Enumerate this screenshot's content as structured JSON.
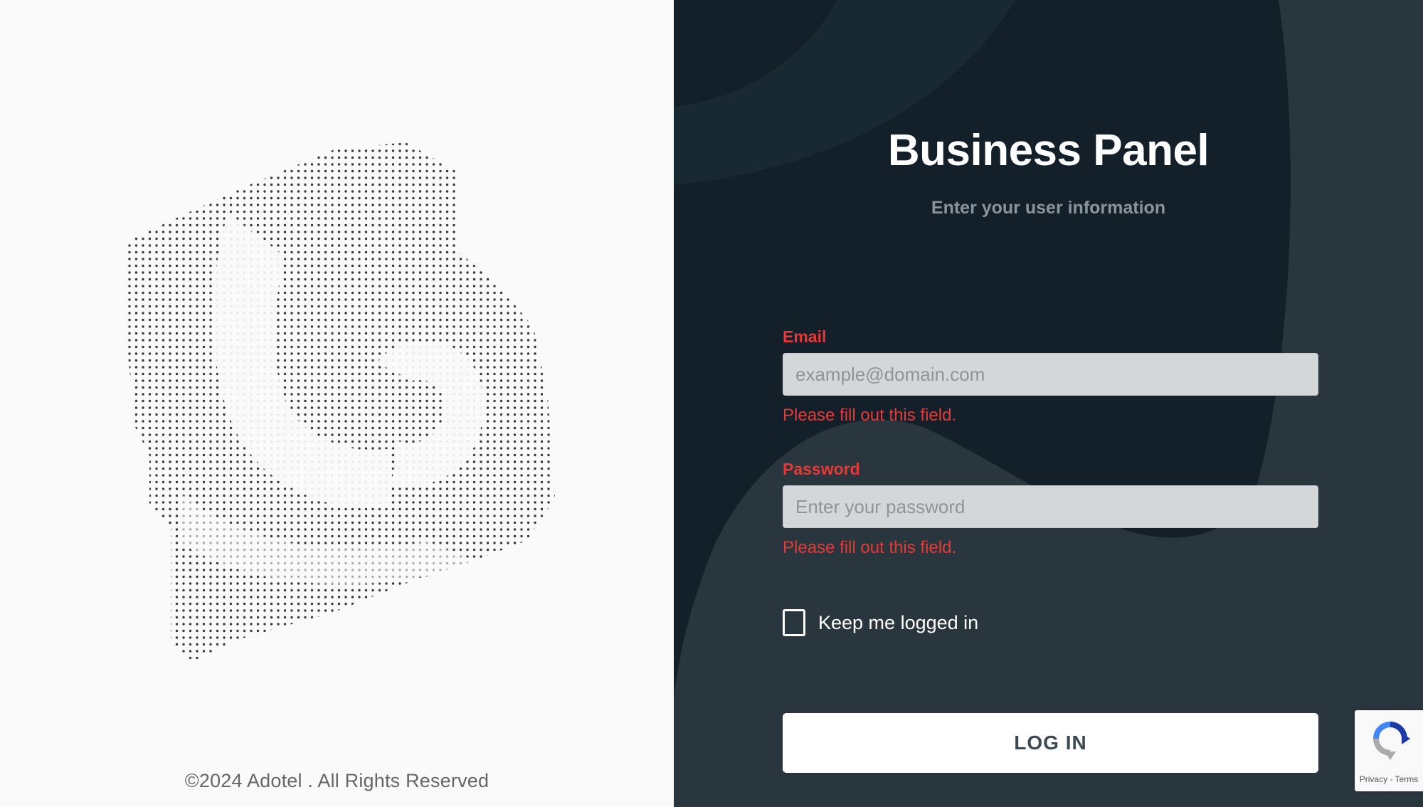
{
  "footer": {
    "copyright": "©2024 Adotel . All Rights Reserved"
  },
  "login": {
    "title": "Business Panel",
    "subtitle": "Enter your user information",
    "email": {
      "label": "Email",
      "value": "",
      "placeholder": "example@domain.com",
      "error": "Please fill out this field."
    },
    "password": {
      "label": "Password",
      "value": "",
      "placeholder": "Enter your password",
      "error": "Please fill out this field."
    },
    "remember": {
      "label": "Keep me logged in",
      "checked": false
    },
    "submit_label": "LOG IN"
  },
  "recaptcha": {
    "links": "Privacy - Terms",
    "icon": "recaptcha-icon"
  },
  "colors": {
    "panel_background": "#2a363d",
    "panel_shape": "#13202a",
    "error": "#e53935",
    "input_background": "#d4d7d9",
    "button_background": "#ffffff"
  },
  "icons": {
    "logo": "dotted-logo-icon",
    "checkbox": "checkbox-icon"
  }
}
